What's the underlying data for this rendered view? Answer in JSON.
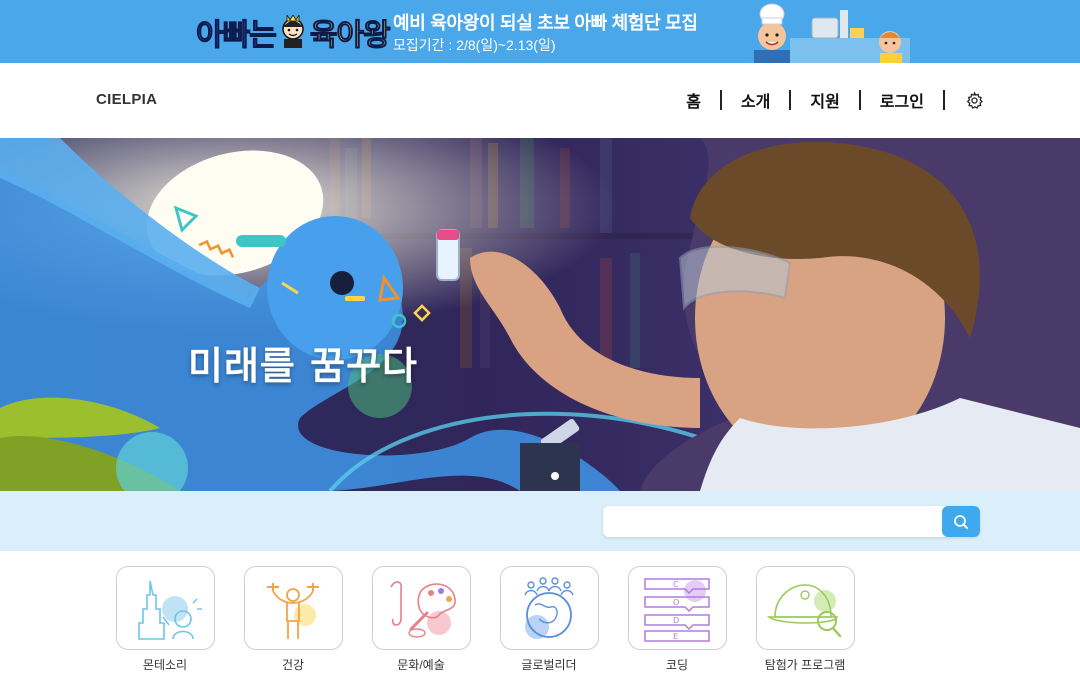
{
  "promo": {
    "logo_part1": "아빠는",
    "logo_part2": "육아왕",
    "title": "예비 육아왕이 되실 초보 아빠 체험단 모집",
    "subtitle": "모집기간 : 2/8(일)~2.13(일)"
  },
  "header": {
    "brand": "CIELPIA",
    "nav": [
      "홈",
      "소개",
      "지원",
      "로그인"
    ]
  },
  "hero": {
    "title": "미래를 꿈꾸다"
  },
  "search": {
    "value": "",
    "placeholder": ""
  },
  "categories": [
    {
      "label": "몬테소리",
      "icon": "montessori-icon",
      "accent": "#6cc6e6"
    },
    {
      "label": "건강",
      "icon": "health-icon",
      "accent": "#f2a24a"
    },
    {
      "label": "문화/예술",
      "icon": "art-icon",
      "accent": "#e8808a"
    },
    {
      "label": "글로벌리더",
      "icon": "globe-icon",
      "accent": "#5b8fe0"
    },
    {
      "label": "코딩",
      "icon": "coding-icon",
      "accent": "#b27be0"
    },
    {
      "label": "탐험가 프로그램",
      "icon": "explorer-icon",
      "accent": "#9cc95c"
    }
  ],
  "colors": {
    "promo_bg": "#4aa7ea",
    "search_band": "#dbeffb",
    "search_button": "#3fa9ee"
  }
}
